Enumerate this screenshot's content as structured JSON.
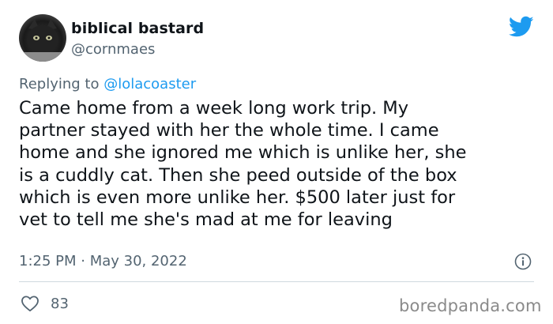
{
  "tweet": {
    "author": {
      "display_name": "biblical bastard",
      "handle": "@cornmaes",
      "avatar": "cat-avatar"
    },
    "platform_icon": "twitter-bird-icon",
    "reply": {
      "prefix": "Replying to ",
      "mention": "@lolacoaster"
    },
    "body": "Came home from a week long work trip. My\npartner stayed with her the whole time. I came\nhome and she ignored me which is unlike her, she\nis a cuddly cat. Then she peed outside of the box\nwhich is even more unlike her. $500 later just for\nvet to tell me she's mad at me for leaving",
    "timestamp": "1:25 PM · May 30, 2022",
    "likes": "83"
  },
  "watermark": "boredpanda.com",
  "colors": {
    "text": "#0f1419",
    "secondary": "#536471",
    "link": "#1d9bf0",
    "twitter_blue": "#1d9bf0",
    "divider": "#cfd9de",
    "watermark": "#8a8a8a"
  }
}
